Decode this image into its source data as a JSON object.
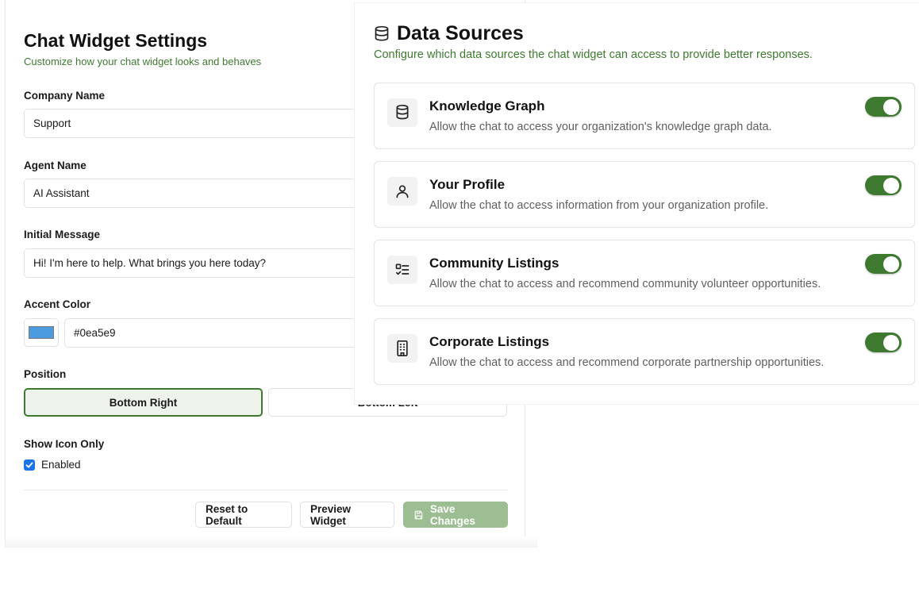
{
  "settings": {
    "title": "Chat Widget Settings",
    "subtitle": "Customize how your chat widget looks and behaves",
    "company_name": {
      "label": "Company Name",
      "value": "Support"
    },
    "agent_name": {
      "label": "Agent Name",
      "value": "AI Assistant"
    },
    "initial_message": {
      "label": "Initial Message",
      "value": "Hi! I'm here to help. What brings you here today?"
    },
    "accent_color": {
      "label": "Accent Color",
      "value": "#0ea5e9",
      "swatch": "#4a9be0"
    },
    "position": {
      "label": "Position",
      "options": [
        "Bottom Right",
        "Bottom Left"
      ],
      "selected": "Bottom Right"
    },
    "show_icon_only": {
      "label": "Show Icon Only",
      "checkbox_label": "Enabled",
      "checked": true
    },
    "actions": {
      "reset": "Reset to Default",
      "preview": "Preview Widget",
      "save": "Save Changes"
    }
  },
  "data_sources": {
    "title": "Data Sources",
    "subtitle": "Configure which data sources the chat widget can access to provide better responses.",
    "items": [
      {
        "name": "Knowledge Graph",
        "description": "Allow the chat to access your organization's knowledge graph data.",
        "icon": "database-icon",
        "enabled": true
      },
      {
        "name": "Your Profile",
        "description": "Allow the chat to access information from your organization profile.",
        "icon": "user-icon",
        "enabled": true
      },
      {
        "name": "Community Listings",
        "description": "Allow the chat to access and recommend community volunteer opportunities.",
        "icon": "list-checks-icon",
        "enabled": true
      },
      {
        "name": "Corporate Listings",
        "description": "Allow the chat to access and recommend corporate partnership opportunities.",
        "icon": "building-icon",
        "enabled": true
      }
    ]
  },
  "colors": {
    "accent_green": "#3d7a2f",
    "save_disabled": "#9dbd93",
    "checkbox_blue": "#1a73e8"
  }
}
